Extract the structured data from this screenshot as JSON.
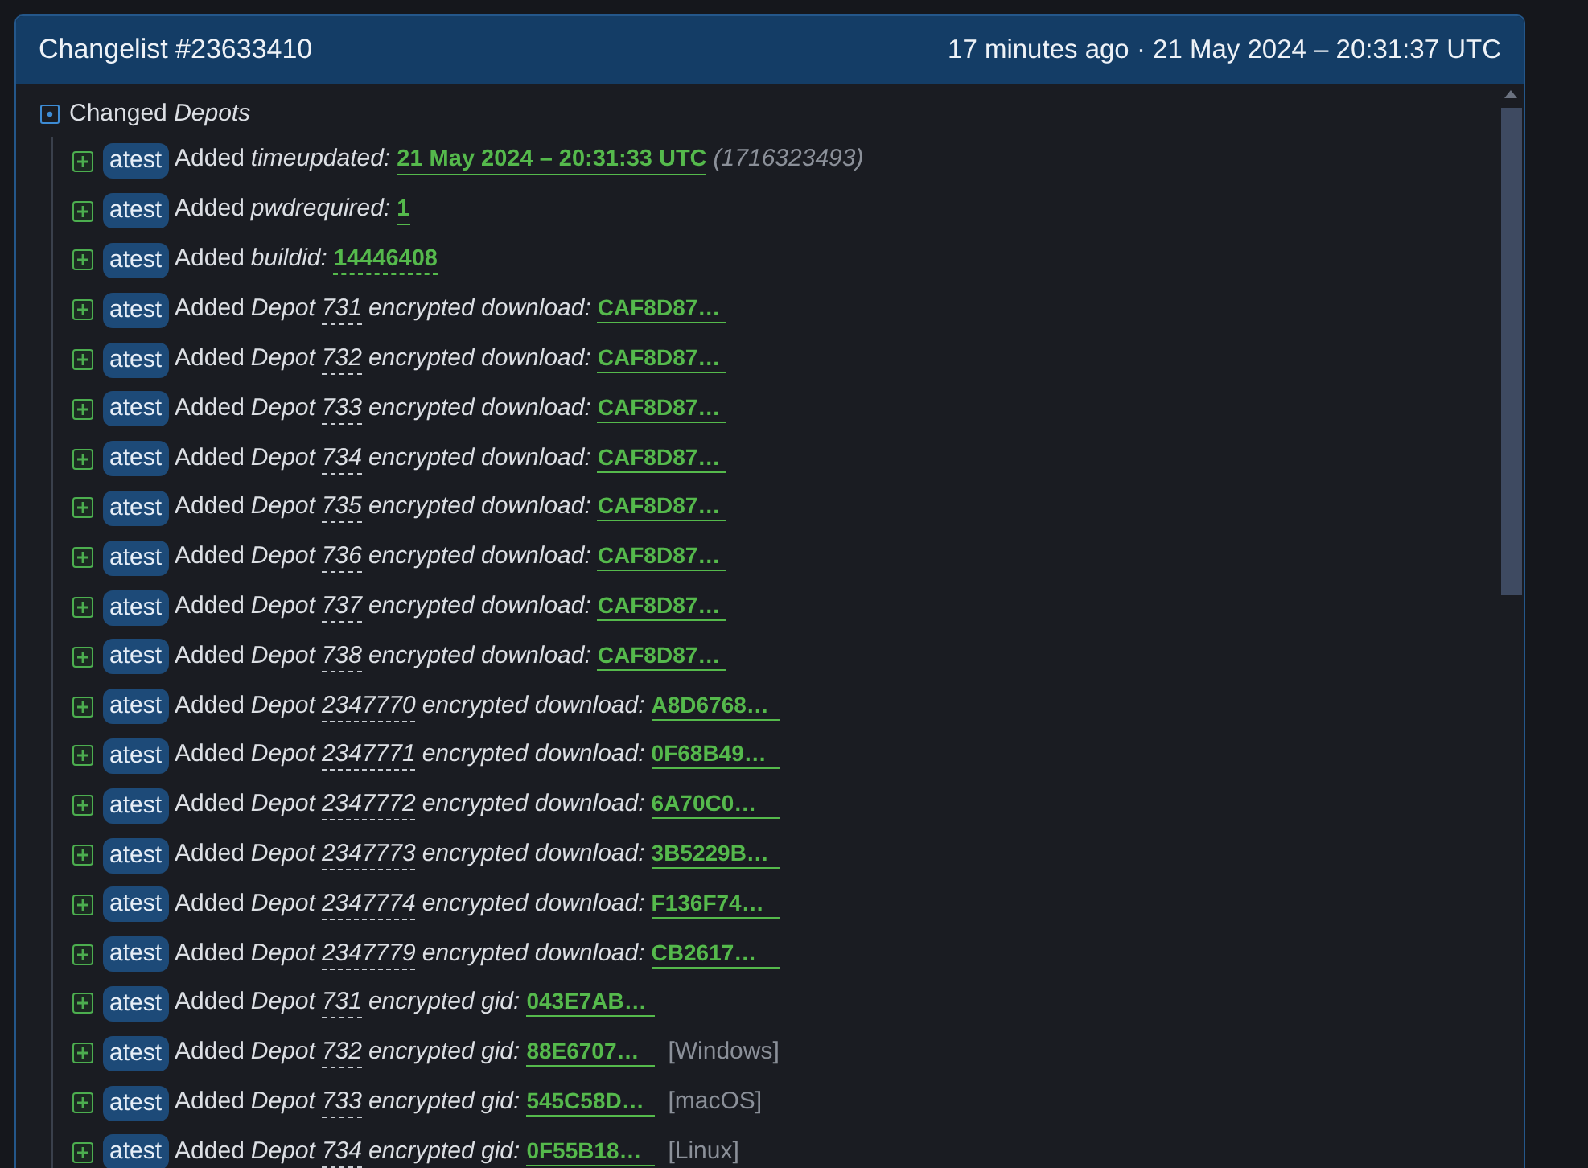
{
  "header": {
    "title": "Changelist #23633410",
    "time": "17 minutes ago · 21 May 2024 – 20:31:37 UTC"
  },
  "tree": {
    "label": "Changed *Depots*",
    "rows": [
      {
        "kind": "field",
        "badge": "atest",
        "action": "Added",
        "key": "timeupdated:",
        "value": "21 May 2024 – 20:31:33 UTC",
        "dashed": false,
        "note": "(1716323493)"
      },
      {
        "kind": "field",
        "badge": "atest",
        "action": "Added",
        "key": "pwdrequired:",
        "value": "1",
        "dashed": false
      },
      {
        "kind": "field",
        "badge": "atest",
        "action": "Added",
        "key": "buildid:",
        "value": "14446408",
        "dashed": true
      },
      {
        "kind": "depot",
        "badge": "atest",
        "action": "Added",
        "depot_word": "Depot",
        "depot_id": "731",
        "key": "encrypted download:",
        "value": "CAF8D87…"
      },
      {
        "kind": "depot",
        "badge": "atest",
        "action": "Added",
        "depot_word": "Depot",
        "depot_id": "732",
        "key": "encrypted download:",
        "value": "CAF8D87…"
      },
      {
        "kind": "depot",
        "badge": "atest",
        "action": "Added",
        "depot_word": "Depot",
        "depot_id": "733",
        "key": "encrypted download:",
        "value": "CAF8D87…"
      },
      {
        "kind": "depot",
        "badge": "atest",
        "action": "Added",
        "depot_word": "Depot",
        "depot_id": "734",
        "key": "encrypted download:",
        "value": "CAF8D87…"
      },
      {
        "kind": "depot",
        "badge": "atest",
        "action": "Added",
        "depot_word": "Depot",
        "depot_id": "735",
        "key": "encrypted download:",
        "value": "CAF8D87…"
      },
      {
        "kind": "depot",
        "badge": "atest",
        "action": "Added",
        "depot_word": "Depot",
        "depot_id": "736",
        "key": "encrypted download:",
        "value": "CAF8D87…"
      },
      {
        "kind": "depot",
        "badge": "atest",
        "action": "Added",
        "depot_word": "Depot",
        "depot_id": "737",
        "key": "encrypted download:",
        "value": "CAF8D87…"
      },
      {
        "kind": "depot",
        "badge": "atest",
        "action": "Added",
        "depot_word": "Depot",
        "depot_id": "738",
        "key": "encrypted download:",
        "value": "CAF8D87…"
      },
      {
        "kind": "depot",
        "badge": "atest",
        "action": "Added",
        "depot_word": "Depot",
        "depot_id": "2347770",
        "key": "encrypted download:",
        "value": "A8D6768…"
      },
      {
        "kind": "depot",
        "badge": "atest",
        "action": "Added",
        "depot_word": "Depot",
        "depot_id": "2347771",
        "key": "encrypted download:",
        "value": "0F68B49…"
      },
      {
        "kind": "depot",
        "badge": "atest",
        "action": "Added",
        "depot_word": "Depot",
        "depot_id": "2347772",
        "key": "encrypted download:",
        "value": "6A70C0…"
      },
      {
        "kind": "depot",
        "badge": "atest",
        "action": "Added",
        "depot_word": "Depot",
        "depot_id": "2347773",
        "key": "encrypted download:",
        "value": "3B5229B…"
      },
      {
        "kind": "depot",
        "badge": "atest",
        "action": "Added",
        "depot_word": "Depot",
        "depot_id": "2347774",
        "key": "encrypted download:",
        "value": "F136F74…"
      },
      {
        "kind": "depot",
        "badge": "atest",
        "action": "Added",
        "depot_word": "Depot",
        "depot_id": "2347779",
        "key": "encrypted download:",
        "value": "CB2617…"
      },
      {
        "kind": "depot",
        "badge": "atest",
        "action": "Added",
        "depot_word": "Depot",
        "depot_id": "731",
        "key": "encrypted gid:",
        "value": "043E7AB…"
      },
      {
        "kind": "depot",
        "badge": "atest",
        "action": "Added",
        "depot_word": "Depot",
        "depot_id": "732",
        "key": "encrypted gid:",
        "value": "88E6707…",
        "platform": "[Windows]"
      },
      {
        "kind": "depot",
        "badge": "atest",
        "action": "Added",
        "depot_word": "Depot",
        "depot_id": "733",
        "key": "encrypted gid:",
        "value": "545C58D…",
        "platform": "[macOS]"
      },
      {
        "kind": "depot",
        "badge": "atest",
        "action": "Added",
        "depot_word": "Depot",
        "depot_id": "734",
        "key": "encrypted gid:",
        "value": "0F55B18…",
        "platform": "[Linux]"
      }
    ]
  }
}
